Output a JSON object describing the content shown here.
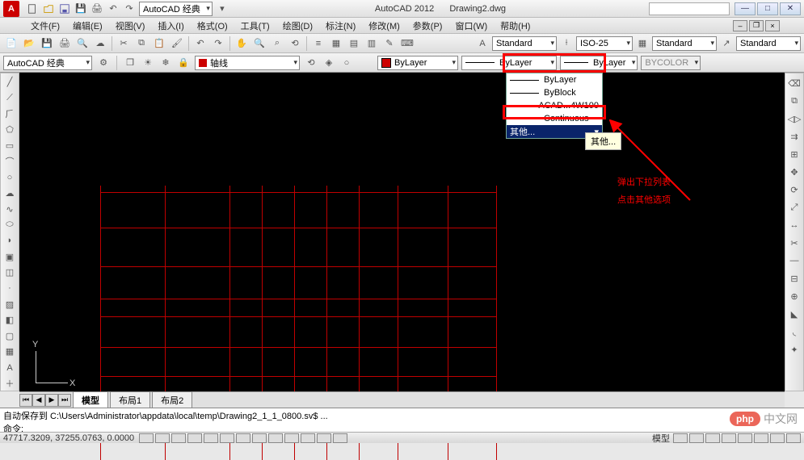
{
  "title": {
    "app": "AutoCAD 2012",
    "doc": "Drawing2.dwg"
  },
  "qat_workspace": "AutoCAD 经典",
  "menus": [
    "文件(F)",
    "编辑(E)",
    "视图(V)",
    "插入(I)",
    "格式(O)",
    "工具(T)",
    "绘图(D)",
    "标注(N)",
    "修改(M)",
    "参数(P)",
    "窗口(W)",
    "帮助(H)"
  ],
  "row3": {
    "text_style": "Standard",
    "dim_style": "ISO-25",
    "table_style": "Standard",
    "mleader_style": "Standard"
  },
  "row4": {
    "workspace": "AutoCAD 经典",
    "layer_name": "轴线",
    "color_control": "ByLayer",
    "linetype_selected": "ByLayer",
    "lineweight": "ByLayer",
    "plotstyle": "BYCOLOR"
  },
  "linetype_options": {
    "bylayer": "ByLayer",
    "byblock": "ByBlock",
    "acad": "ACAD...4W100",
    "continuous": "Continuous",
    "other": "其他..."
  },
  "tooltip": "其他...",
  "annotation": {
    "l1": "弹出下拉列表",
    "l2": "点击其他选项"
  },
  "ucs": {
    "x": "X",
    "y": "Y"
  },
  "tabs": {
    "model": "模型",
    "layout1": "布局1",
    "layout2": "布局2"
  },
  "cmd": {
    "line1": "自动保存到 C:\\Users\\Administrator\\appdata\\local\\temp\\Drawing2_1_1_0800.sv$ ...",
    "line2": "命令:",
    "prompt": "命令:"
  },
  "status": {
    "coords": "47717.3209, 37255.0763, 0.0000",
    "right_label": "模型"
  },
  "watermark": {
    "badge": "php",
    "text": "中文网"
  }
}
